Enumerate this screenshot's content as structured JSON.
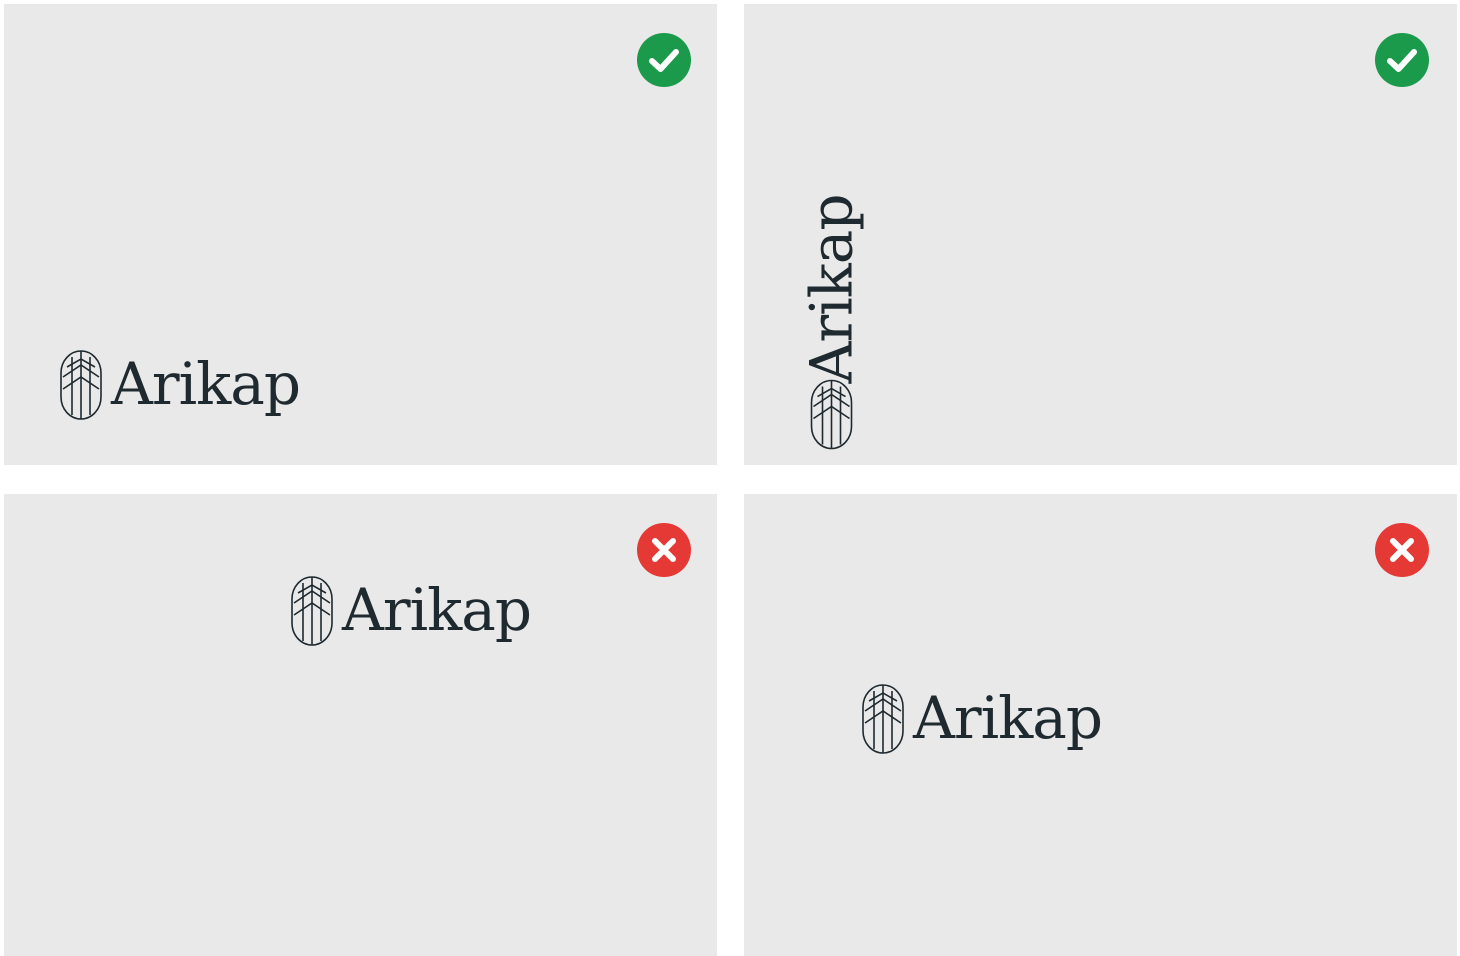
{
  "brand": {
    "name": "Arikap",
    "text_color": "#1f2a30"
  },
  "panels": [
    {
      "status": "correct",
      "badge_icon": "check-icon",
      "badge_color": "#1a9a4a",
      "orientation": "horizontal",
      "placement": "bottom-left"
    },
    {
      "status": "correct",
      "badge_icon": "check-icon",
      "badge_color": "#1a9a4a",
      "orientation": "vertical",
      "placement": "bottom-left"
    },
    {
      "status": "incorrect",
      "badge_icon": "cross-icon",
      "badge_color": "#e53935",
      "orientation": "horizontal",
      "placement": "top-center"
    },
    {
      "status": "incorrect",
      "badge_icon": "cross-icon",
      "badge_color": "#e53935",
      "orientation": "horizontal",
      "placement": "middle-center"
    }
  ],
  "background_color": "#e9e9e9"
}
